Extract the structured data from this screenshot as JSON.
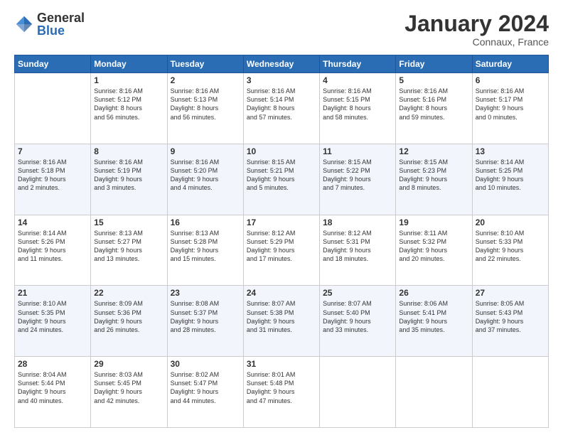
{
  "logo": {
    "general": "General",
    "blue": "Blue"
  },
  "title": "January 2024",
  "location": "Connaux, France",
  "days_of_week": [
    "Sunday",
    "Monday",
    "Tuesday",
    "Wednesday",
    "Thursday",
    "Friday",
    "Saturday"
  ],
  "weeks": [
    [
      {
        "day": "",
        "info": ""
      },
      {
        "day": "1",
        "info": "Sunrise: 8:16 AM\nSunset: 5:12 PM\nDaylight: 8 hours\nand 56 minutes."
      },
      {
        "day": "2",
        "info": "Sunrise: 8:16 AM\nSunset: 5:13 PM\nDaylight: 8 hours\nand 56 minutes."
      },
      {
        "day": "3",
        "info": "Sunrise: 8:16 AM\nSunset: 5:14 PM\nDaylight: 8 hours\nand 57 minutes."
      },
      {
        "day": "4",
        "info": "Sunrise: 8:16 AM\nSunset: 5:15 PM\nDaylight: 8 hours\nand 58 minutes."
      },
      {
        "day": "5",
        "info": "Sunrise: 8:16 AM\nSunset: 5:16 PM\nDaylight: 8 hours\nand 59 minutes."
      },
      {
        "day": "6",
        "info": "Sunrise: 8:16 AM\nSunset: 5:17 PM\nDaylight: 9 hours\nand 0 minutes."
      }
    ],
    [
      {
        "day": "7",
        "info": "Sunrise: 8:16 AM\nSunset: 5:18 PM\nDaylight: 9 hours\nand 2 minutes."
      },
      {
        "day": "8",
        "info": "Sunrise: 8:16 AM\nSunset: 5:19 PM\nDaylight: 9 hours\nand 3 minutes."
      },
      {
        "day": "9",
        "info": "Sunrise: 8:16 AM\nSunset: 5:20 PM\nDaylight: 9 hours\nand 4 minutes."
      },
      {
        "day": "10",
        "info": "Sunrise: 8:15 AM\nSunset: 5:21 PM\nDaylight: 9 hours\nand 5 minutes."
      },
      {
        "day": "11",
        "info": "Sunrise: 8:15 AM\nSunset: 5:22 PM\nDaylight: 9 hours\nand 7 minutes."
      },
      {
        "day": "12",
        "info": "Sunrise: 8:15 AM\nSunset: 5:23 PM\nDaylight: 9 hours\nand 8 minutes."
      },
      {
        "day": "13",
        "info": "Sunrise: 8:14 AM\nSunset: 5:25 PM\nDaylight: 9 hours\nand 10 minutes."
      }
    ],
    [
      {
        "day": "14",
        "info": "Sunrise: 8:14 AM\nSunset: 5:26 PM\nDaylight: 9 hours\nand 11 minutes."
      },
      {
        "day": "15",
        "info": "Sunrise: 8:13 AM\nSunset: 5:27 PM\nDaylight: 9 hours\nand 13 minutes."
      },
      {
        "day": "16",
        "info": "Sunrise: 8:13 AM\nSunset: 5:28 PM\nDaylight: 9 hours\nand 15 minutes."
      },
      {
        "day": "17",
        "info": "Sunrise: 8:12 AM\nSunset: 5:29 PM\nDaylight: 9 hours\nand 17 minutes."
      },
      {
        "day": "18",
        "info": "Sunrise: 8:12 AM\nSunset: 5:31 PM\nDaylight: 9 hours\nand 18 minutes."
      },
      {
        "day": "19",
        "info": "Sunrise: 8:11 AM\nSunset: 5:32 PM\nDaylight: 9 hours\nand 20 minutes."
      },
      {
        "day": "20",
        "info": "Sunrise: 8:10 AM\nSunset: 5:33 PM\nDaylight: 9 hours\nand 22 minutes."
      }
    ],
    [
      {
        "day": "21",
        "info": "Sunrise: 8:10 AM\nSunset: 5:35 PM\nDaylight: 9 hours\nand 24 minutes."
      },
      {
        "day": "22",
        "info": "Sunrise: 8:09 AM\nSunset: 5:36 PM\nDaylight: 9 hours\nand 26 minutes."
      },
      {
        "day": "23",
        "info": "Sunrise: 8:08 AM\nSunset: 5:37 PM\nDaylight: 9 hours\nand 28 minutes."
      },
      {
        "day": "24",
        "info": "Sunrise: 8:07 AM\nSunset: 5:38 PM\nDaylight: 9 hours\nand 31 minutes."
      },
      {
        "day": "25",
        "info": "Sunrise: 8:07 AM\nSunset: 5:40 PM\nDaylight: 9 hours\nand 33 minutes."
      },
      {
        "day": "26",
        "info": "Sunrise: 8:06 AM\nSunset: 5:41 PM\nDaylight: 9 hours\nand 35 minutes."
      },
      {
        "day": "27",
        "info": "Sunrise: 8:05 AM\nSunset: 5:43 PM\nDaylight: 9 hours\nand 37 minutes."
      }
    ],
    [
      {
        "day": "28",
        "info": "Sunrise: 8:04 AM\nSunset: 5:44 PM\nDaylight: 9 hours\nand 40 minutes."
      },
      {
        "day": "29",
        "info": "Sunrise: 8:03 AM\nSunset: 5:45 PM\nDaylight: 9 hours\nand 42 minutes."
      },
      {
        "day": "30",
        "info": "Sunrise: 8:02 AM\nSunset: 5:47 PM\nDaylight: 9 hours\nand 44 minutes."
      },
      {
        "day": "31",
        "info": "Sunrise: 8:01 AM\nSunset: 5:48 PM\nDaylight: 9 hours\nand 47 minutes."
      },
      {
        "day": "",
        "info": ""
      },
      {
        "day": "",
        "info": ""
      },
      {
        "day": "",
        "info": ""
      }
    ]
  ]
}
